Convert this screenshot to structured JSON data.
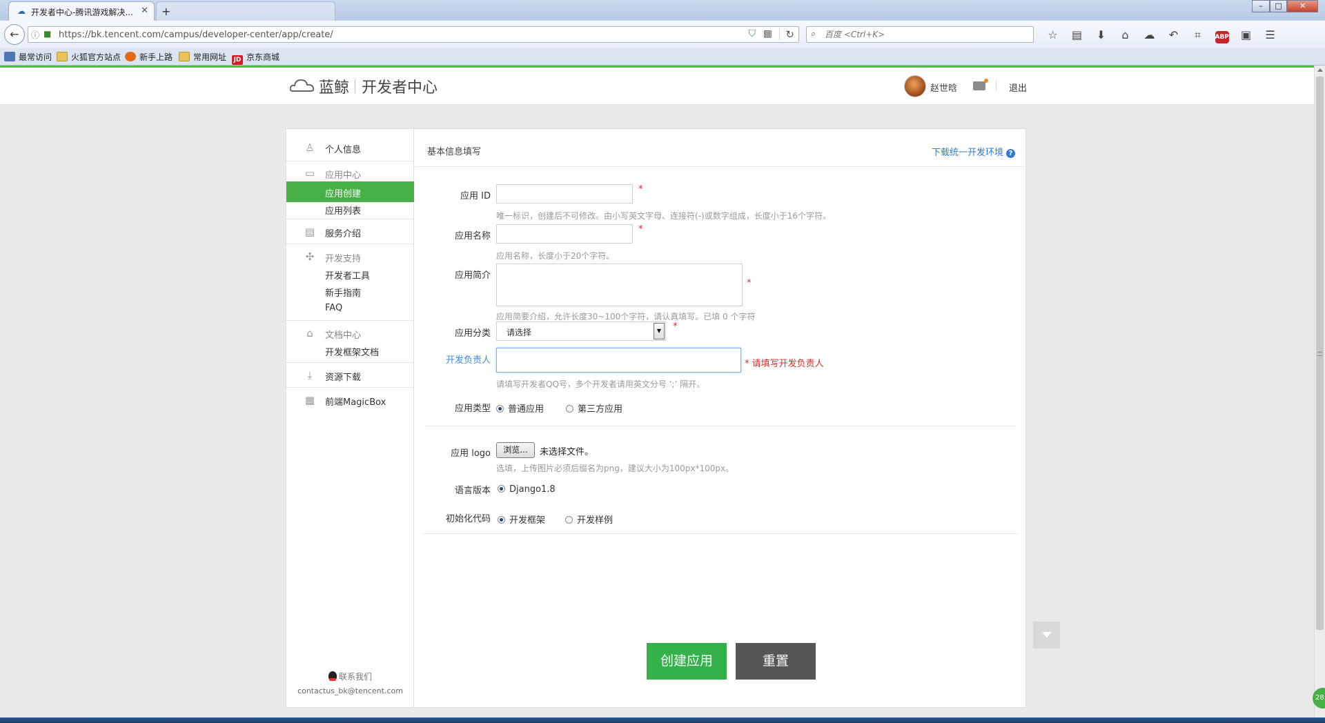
{
  "browser": {
    "tab_title": "开发者中心-腾讯游戏解决...",
    "tab_close": "✕",
    "new_tab": "+",
    "url": "https://bk.tencent.com/campus/developer-center/app/create/",
    "search_placeholder": "百度 <Ctrl+K>",
    "bookmarks": [
      {
        "label": "最常访问"
      },
      {
        "label": "火狐官方站点"
      },
      {
        "label": "新手上路"
      },
      {
        "label": "常用网址"
      },
      {
        "label": "京东商城"
      }
    ]
  },
  "header": {
    "logo": "蓝鲸",
    "subtitle": "开发者中心",
    "user_name": "赵世晗",
    "logout": "退出"
  },
  "sidebar": {
    "personal_info": "个人信息",
    "app_center": "应用中心",
    "app_create": "应用创建",
    "app_list": "应用列表",
    "service_intro": "服务介绍",
    "dev_support": "开发支持",
    "dev_tools": "开发者工具",
    "beginner_guide": "新手指南",
    "faq": "FAQ",
    "doc_center": "文档中心",
    "framework_doc": "开发框架文档",
    "resource_download": "资源下载",
    "magicbox": "前端MagicBox",
    "contact": "联系我们",
    "contact_email": "contactus_bk@tencent.com"
  },
  "content": {
    "title": "基本信息填写",
    "download_link": "下载统一开发环境",
    "required_mark": "*",
    "app_id": {
      "label": "应用 ID",
      "value": "",
      "hint": "唯一标识，创建后不可修改。由小写英文字母、连接符(-)或数字组成，长度小于16个字符。"
    },
    "app_name": {
      "label": "应用名称",
      "value": "",
      "hint": "应用名称，长度小于20个字符。"
    },
    "app_intro": {
      "label": "应用简介",
      "value": "",
      "hint": "应用简要介绍，允许长度30~100个字符，请认真填写。已填 0 个字符"
    },
    "app_category": {
      "label": "应用分类",
      "selected": "请选择"
    },
    "developer": {
      "label": "开发负责人",
      "value": "",
      "error": "* 请填写开发负责人",
      "hint": "请填写开发者QQ号，多个开发者请用英文分号 ‘;’ 隔开。"
    },
    "app_type": {
      "label": "应用类型",
      "options": [
        "普通应用",
        "第三方应用"
      ],
      "selected": "普通应用"
    },
    "app_logo": {
      "label": "应用 logo",
      "button": "浏览...",
      "status": "未选择文件。",
      "hint": "选填，上传图片必须后缀名为png，建议大小为100px*100px。"
    },
    "language": {
      "label": "语言版本",
      "option": "Django1.8"
    },
    "init_code": {
      "label": "初始化代码",
      "options": [
        "开发框架",
        "开发样例"
      ],
      "selected": "开发框架"
    },
    "create_button": "创建应用",
    "reset_button": "重置"
  },
  "misc": {
    "badge": "28"
  }
}
